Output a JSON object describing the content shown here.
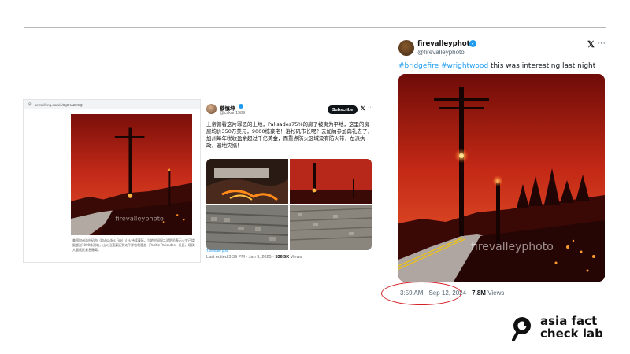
{
  "panel_news": {
    "url": "news.ifeng.com/c/8g0Ka2H9Qf",
    "body_text": "美国加州洛杉矶市（Palisades Fire）山火持续蔓延。当地时间周二消防员表示火灾已烧毁超过1000栋建筑，山火迅速蔓延到太平洋帕利塞兹（Pacific Palisades）社区，导致大量居民紧急撤离。",
    "watermark": "firevalleyphoto"
  },
  "panel_tweet_cn": {
    "name": "蔡慎坤",
    "handle": "@cskun1989",
    "subscribe_label": "Subscribe",
    "x_glyph": "𝕏",
    "more_glyph": "···",
    "body": "上帝俯看这片罪恶的土地，Palisades75%的房子被夷为平地，这里的房屋均价350万美元，9000栋豪宅！洛杉矶市长呢？去加纳参加典礼去了，加州每年税收盈余超过千亿美金，而重点防火区域没有防火带，左派执政，遍地灾祸！",
    "translate_label": "Translate post",
    "meta_time": "Last edited 3:39 PM · Jan 9, 2025 · ",
    "meta_views_count": "536.5K",
    "meta_views_label": " Views"
  },
  "panel_tweet_main": {
    "name": "firevalleyphoto",
    "handle": "@firevalleyphoto",
    "verified_glyph": "✓",
    "x_glyph": "𝕏",
    "more_glyph": "···",
    "hashtag1": "#bridgefire",
    "hashtag2": "#wrightwood",
    "text": " this was interesting last night",
    "watermark": "firevalleyphoto",
    "timestamp": "3:59 AM · Sep 12, 2024 · ",
    "views_count": "7.8M",
    "views_label": " Views"
  },
  "logo": {
    "line1": "asia fact",
    "line2": "check lab"
  },
  "colors": {
    "fire_red": "#c0241a",
    "link_blue": "#1d9bf0",
    "highlight_circle": "#d4232b"
  },
  "icons": [
    "verified-badge-icon",
    "x-logo-icon",
    "more-icon",
    "magnifier-logo-icon"
  ]
}
